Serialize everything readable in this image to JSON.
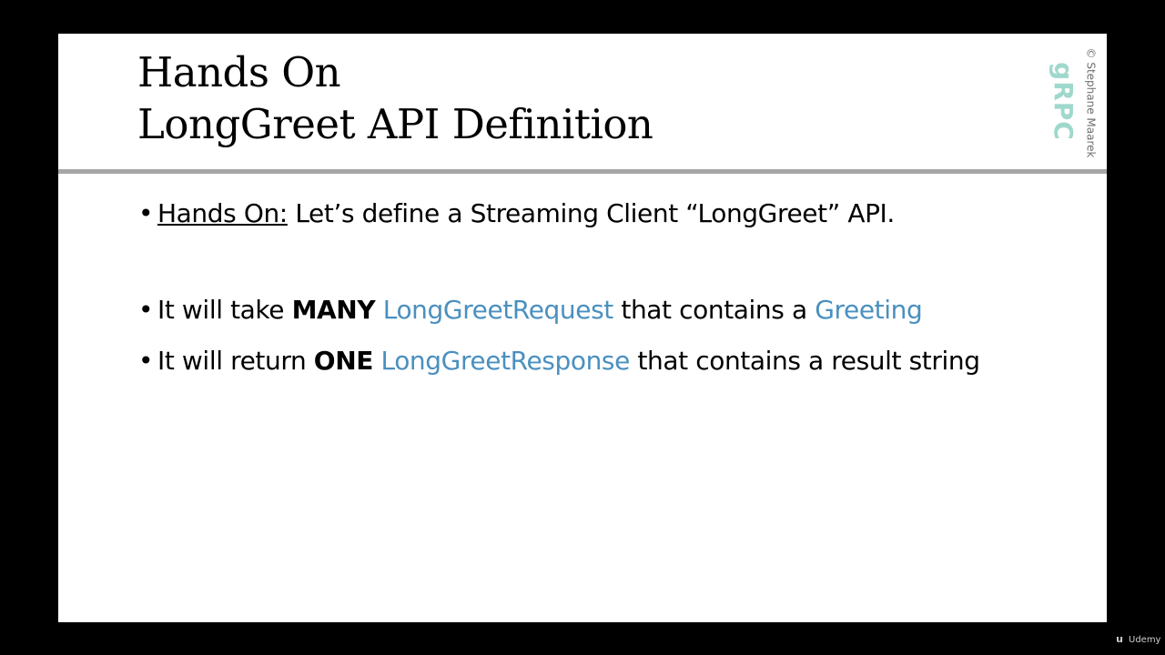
{
  "slide": {
    "title_line1": "Hands On",
    "title_line2": "LongGreet API Definition",
    "logo_text": "gRPC",
    "copyright": "© Stephane Maarek"
  },
  "bullets": [
    {
      "label": "Hands On:",
      "text": " Let’s define a Streaming Client “LongGreet” API."
    },
    {
      "prefix": "It will take ",
      "strong": "MANY",
      "space": " ",
      "highlight": "LongGreetRequest",
      "middle": " that contains a ",
      "highlight2": "Greeting"
    },
    {
      "prefix": "It will return ",
      "strong": "ONE",
      "space": " ",
      "highlight": "LongGreetResponse",
      "suffix": " that contains a result string"
    }
  ],
  "watermark": {
    "icon": "udemy-logo-icon",
    "label": "Udemy"
  },
  "colors": {
    "background": "#000000",
    "slide": "#ffffff",
    "divider": "#a6a6a6",
    "highlight": "#4a90bf",
    "logo": "#9fd8cc"
  }
}
